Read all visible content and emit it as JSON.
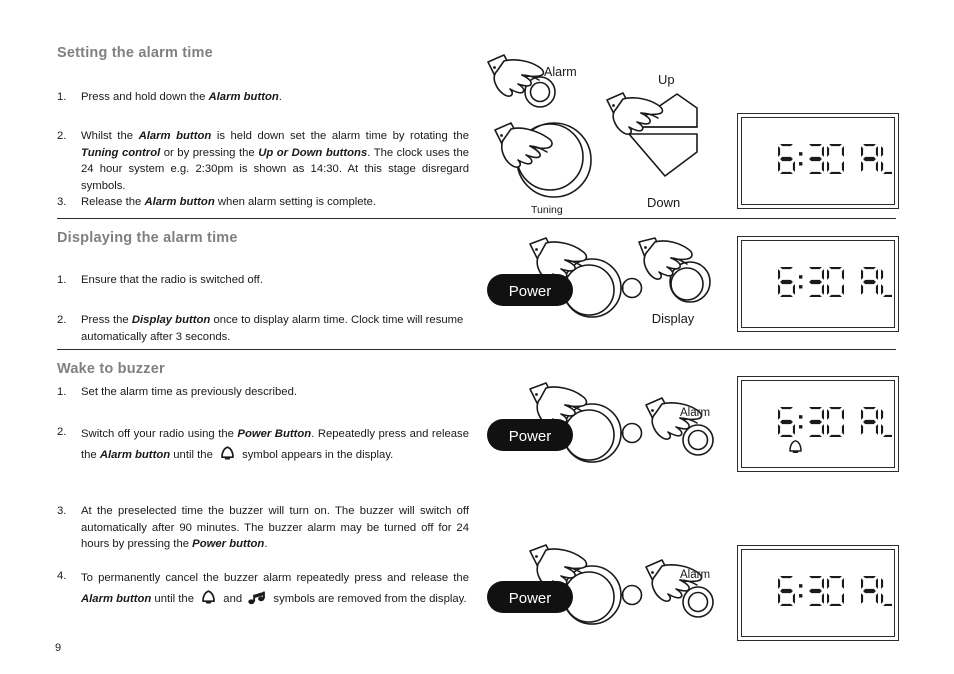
{
  "document": {
    "page_number": "9"
  },
  "sections": [
    {
      "heading": "Setting the alarm time",
      "items": [
        {
          "number": "1.",
          "runs": [
            {
              "t": "Press and hold down the ",
              "b": false
            },
            {
              "t": "Alarm button",
              "b": true
            },
            {
              "t": ".",
              "b": false
            }
          ]
        },
        {
          "number": "2.",
          "runs": [
            {
              "t": "Whilst the ",
              "b": false
            },
            {
              "t": "Alarm button",
              "b": true
            },
            {
              "t": " is held down set the alarm time by rotating the ",
              "b": false
            },
            {
              "t": "Tuning control",
              "b": true
            },
            {
              "t": " or by pressing the ",
              "b": false
            },
            {
              "t": "Up or Down buttons",
              "b": true
            },
            {
              "t": ". The clock uses the 24 hour system e.g. 2:30pm is shown as 14:30. At this stage disregard symbols.",
              "b": false
            }
          ]
        },
        {
          "number": "3.",
          "runs": [
            {
              "t": "Release the ",
              "b": false
            },
            {
              "t": "Alarm button",
              "b": true
            },
            {
              "t": " when alarm setting is complete.",
              "b": false
            }
          ]
        }
      ]
    },
    {
      "heading": "Displaying the alarm time",
      "items": [
        {
          "number": "1.",
          "runs": [
            {
              "t": "Ensure that the radio is switched off.",
              "b": false
            }
          ]
        },
        {
          "number": "2.",
          "runs": [
            {
              "t": "Press the ",
              "b": false
            },
            {
              "t": "Display button",
              "b": true
            },
            {
              "t": " once to display alarm time. Clock time will resume automatically after 3 seconds.",
              "b": false
            }
          ]
        }
      ]
    },
    {
      "heading": "Wake  to buzzer",
      "items": [
        {
          "number": "1.",
          "runs": [
            {
              "t": "Set the alarm time as previously described.",
              "b": false
            }
          ]
        },
        {
          "number": "2.",
          "runs": [
            {
              "t": "Switch off your radio using the ",
              "b": false
            },
            {
              "t": "Power Button",
              "b": true
            },
            {
              "t": ". Repeatedly press and release the ",
              "b": false
            },
            {
              "t": "Alarm button",
              "b": true
            },
            {
              "t": " until the ",
              "b": false
            },
            {
              "icon": "bell-icon"
            },
            {
              "t": " symbol appears in the display.",
              "b": false
            }
          ]
        },
        {
          "number": "3.",
          "runs": [
            {
              "t": "At the preselected time the buzzer will turn on. The buzzer will switch off automatically after 90 minutes. The buzzer alarm may be turned off for 24 hours by pressing the ",
              "b": false
            },
            {
              "t": "Power button",
              "b": true
            },
            {
              "t": ".",
              "b": false
            }
          ]
        },
        {
          "number": "4.",
          "runs": [
            {
              "t": "To permanently cancel the buzzer alarm repeatedly press and release the ",
              "b": false
            },
            {
              "t": "Alarm button",
              "b": true
            },
            {
              "t": " until the ",
              "b": false
            },
            {
              "icon": "bell-icon"
            },
            {
              "t": " and ",
              "b": false
            },
            {
              "icon": "music-note-icon"
            },
            {
              "t": " symbols are removed from the display.",
              "b": false
            }
          ]
        }
      ]
    }
  ],
  "illustrations": {
    "set_alarm": {
      "alarm_label": "Alarm",
      "tuning_label": "Tuning",
      "up_label": "Up",
      "down_label": "Down"
    },
    "display_alarm": {
      "power_label": "Power",
      "display_label": "Display"
    },
    "wake_buzzer_on": {
      "power_label": "Power",
      "alarm_label": "Alarm"
    },
    "wake_buzzer_off": {
      "power_label": "Power",
      "alarm_label": "Alarm"
    }
  },
  "lcd_displays": [
    {
      "time": "6:30",
      "mode": "AL",
      "bell": false
    },
    {
      "time": "6:30",
      "mode": "AL",
      "bell": false
    },
    {
      "time": "6:30",
      "mode": "AL",
      "bell": true
    },
    {
      "time": "6:30",
      "mode": "AL",
      "bell": false
    }
  ],
  "colors": {
    "heading_gray": "#808080",
    "body_black": "#1a1a1a",
    "rule": "#2a2a2a",
    "pill_black": "#111111",
    "pill_text": "#ffffff"
  }
}
